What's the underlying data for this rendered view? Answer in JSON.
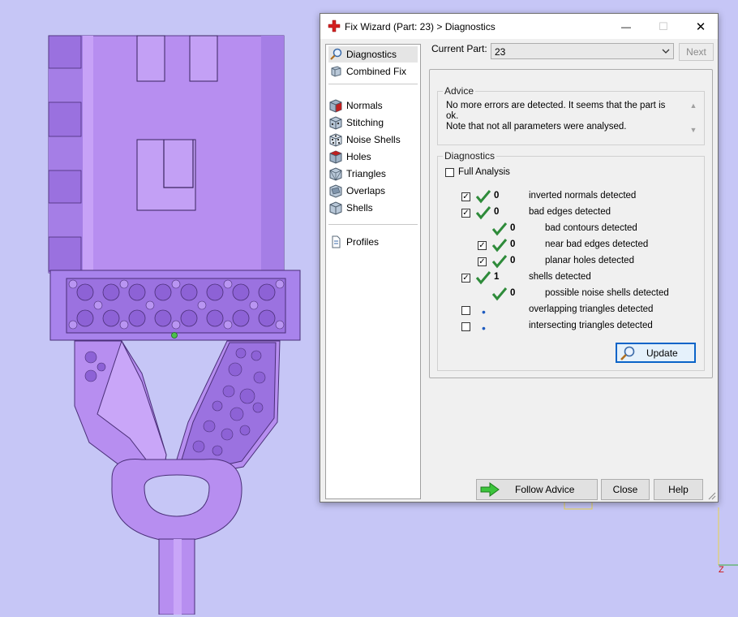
{
  "window": {
    "title": "Fix Wizard (Part: 23) > Diagnostics",
    "minimize_glyph": "—",
    "maximize_glyph": "☐",
    "close_glyph": "✕"
  },
  "nav": {
    "items": [
      {
        "label": "Diagnostics",
        "icon": "magnifier-icon"
      },
      {
        "label": "Combined Fix",
        "icon": "cube-icon"
      },
      {
        "label": "Normals",
        "icon": "cube-red-icon"
      },
      {
        "label": "Stitching",
        "icon": "cube-dots-icon"
      },
      {
        "label": "Noise Shells",
        "icon": "dice-icon"
      },
      {
        "label": "Holes",
        "icon": "cube-red-icon"
      },
      {
        "label": "Triangles",
        "icon": "triangle-cube-icon"
      },
      {
        "label": "Overlaps",
        "icon": "overlap-cube-icon"
      },
      {
        "label": "Shells",
        "icon": "cube-icon"
      },
      {
        "label": "Profiles",
        "icon": "document-icon"
      }
    ]
  },
  "current_part": {
    "label": "Current Part:",
    "value": "23"
  },
  "next_button": "Next",
  "advice": {
    "title": "Advice",
    "line1": "No more errors are detected. It seems that the part is ok.",
    "line2": "Note that not all parameters were analysed."
  },
  "diagnostics": {
    "title": "Diagnostics",
    "full_analysis": "Full Analysis",
    "rows": [
      {
        "checkbox": true,
        "checked": true,
        "status": "ok",
        "count": "0",
        "label": "inverted normals detected"
      },
      {
        "checkbox": true,
        "checked": true,
        "status": "ok",
        "count": "0",
        "label": "bad edges detected"
      },
      {
        "checkbox": false,
        "checked": false,
        "status": "ok",
        "count": "0",
        "label": "bad contours detected"
      },
      {
        "checkbox": true,
        "checked": true,
        "status": "ok",
        "count": "0",
        "label": "near bad edges detected"
      },
      {
        "checkbox": true,
        "checked": true,
        "status": "ok",
        "count": "0",
        "label": "planar holes detected"
      },
      {
        "checkbox": true,
        "checked": true,
        "status": "ok",
        "count": "1",
        "label": "shells detected"
      },
      {
        "checkbox": false,
        "checked": false,
        "status": "ok",
        "count": "0",
        "label": "possible noise shells detected"
      },
      {
        "checkbox": true,
        "checked": false,
        "status": "dot",
        "count": "",
        "label": "overlapping triangles detected"
      },
      {
        "checkbox": true,
        "checked": false,
        "status": "dot",
        "count": "",
        "label": "intersecting triangles detected"
      }
    ],
    "update_button": "Update"
  },
  "buttons": {
    "follow_advice": "Follow Advice",
    "close": "Close",
    "help": "Help"
  },
  "viewport": {
    "axis_label": "Z"
  },
  "colors": {
    "background": "#c6c6f6",
    "model": "#b78ef0",
    "model_dark": "#8f5cd3",
    "ok_tick": "#2e8b3a",
    "accent": "#0a64c8"
  }
}
